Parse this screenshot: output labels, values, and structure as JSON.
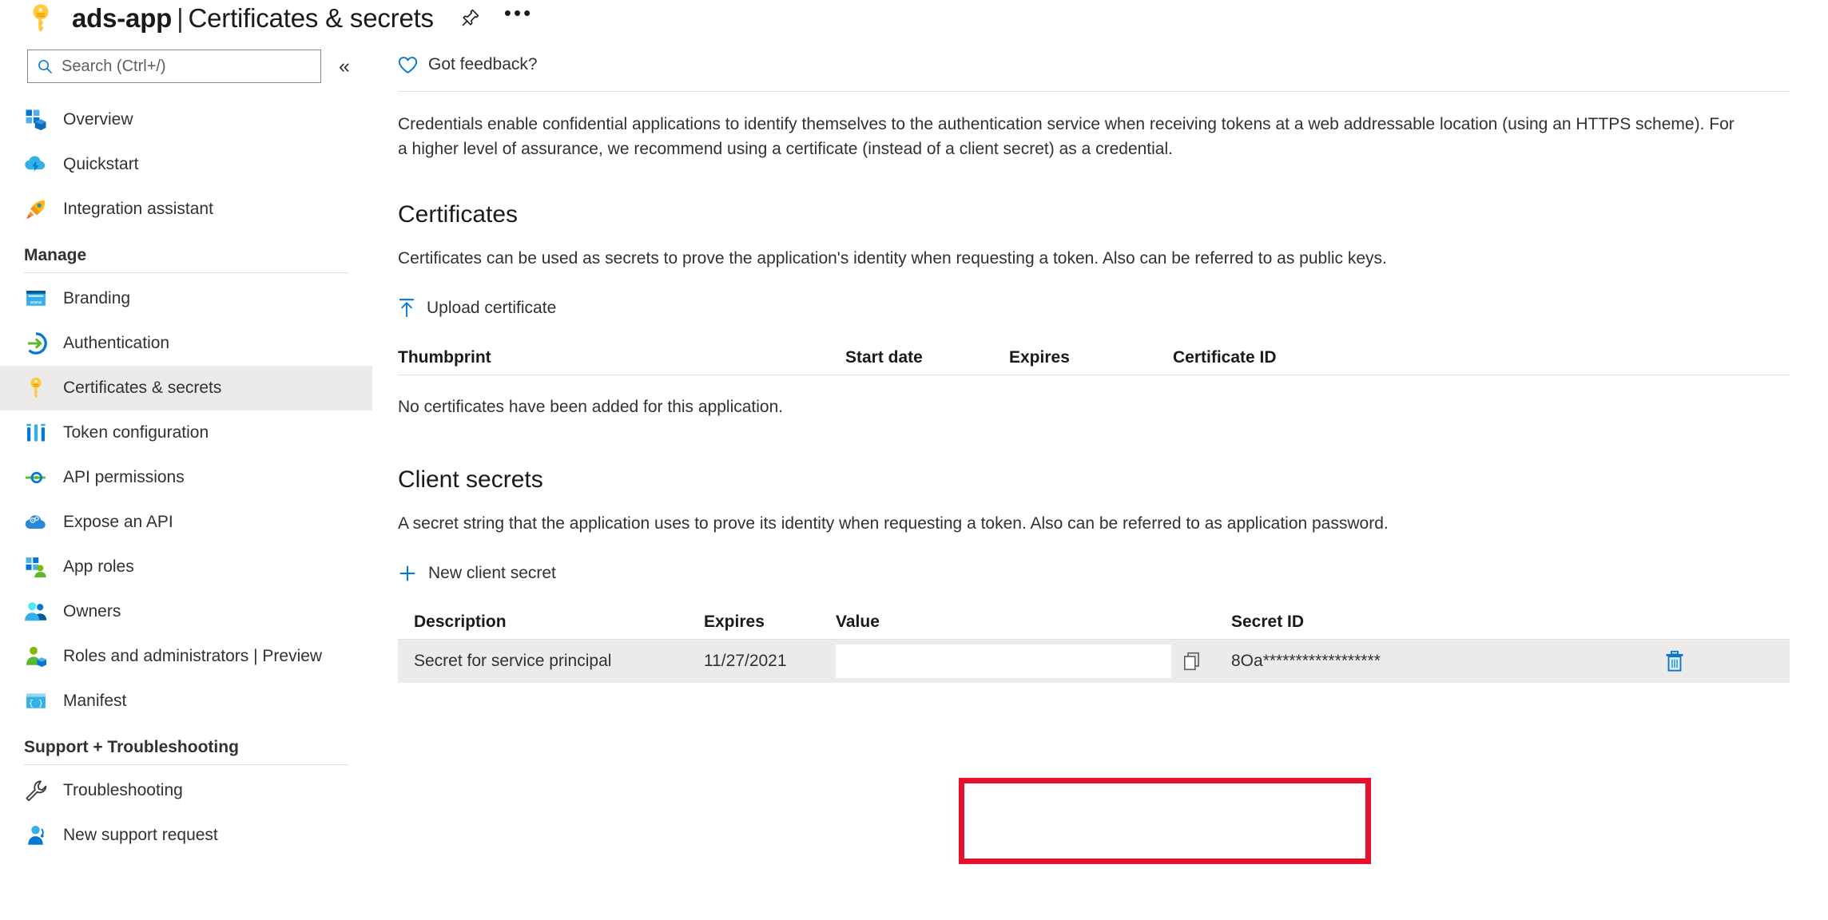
{
  "header": {
    "app_name": "ads-app",
    "separator": "|",
    "page_name": "Certificates & secrets",
    "key_icon": "key-icon",
    "pin_icon": "pin-icon",
    "more_label": "•••"
  },
  "sidebar": {
    "search": {
      "placeholder": "Search (Ctrl+/)",
      "value": "",
      "icon": "search-icon"
    },
    "collapse_label": "«",
    "top_items": [
      {
        "label": "Overview",
        "icon": "overview-icon",
        "selected": false
      },
      {
        "label": "Quickstart",
        "icon": "quickstart-icon",
        "selected": false
      },
      {
        "label": "Integration assistant",
        "icon": "rocket-icon",
        "selected": false
      }
    ],
    "groups": [
      {
        "title": "Manage",
        "items": [
          {
            "label": "Branding",
            "icon": "branding-icon",
            "selected": false
          },
          {
            "label": "Authentication",
            "icon": "authentication-icon",
            "selected": false
          },
          {
            "label": "Certificates & secrets",
            "icon": "key-icon",
            "selected": true
          },
          {
            "label": "Token configuration",
            "icon": "token-icon",
            "selected": false
          },
          {
            "label": "API permissions",
            "icon": "api-permissions-icon",
            "selected": false
          },
          {
            "label": "Expose an API",
            "icon": "expose-api-icon",
            "selected": false
          },
          {
            "label": "App roles",
            "icon": "app-roles-icon",
            "selected": false
          },
          {
            "label": "Owners",
            "icon": "owners-icon",
            "selected": false
          },
          {
            "label": "Roles and administrators | Preview",
            "icon": "roles-admin-icon",
            "selected": false
          },
          {
            "label": "Manifest",
            "icon": "manifest-icon",
            "selected": false
          }
        ]
      },
      {
        "title": "Support + Troubleshooting",
        "items": [
          {
            "label": "Troubleshooting",
            "icon": "wrench-icon",
            "selected": false
          },
          {
            "label": "New support request",
            "icon": "support-agent-icon",
            "selected": false
          }
        ]
      }
    ]
  },
  "main": {
    "feedback": {
      "label": "Got feedback?",
      "icon": "heart-icon"
    },
    "intro": "Credentials enable confidential applications to identify themselves to the authentication service when receiving tokens at a web addressable location (using an HTTPS scheme). For a higher level of assurance, we recommend using a certificate (instead of a client secret) as a credential.",
    "certificates": {
      "heading": "Certificates",
      "description": "Certificates can be used as secrets to prove the application's identity when requesting a token. Also can be referred to as public keys.",
      "upload_button": {
        "label": "Upload certificate",
        "icon": "upload-icon"
      },
      "columns": [
        "Thumbprint",
        "Start date",
        "Expires",
        "Certificate ID"
      ],
      "rows": [],
      "empty_message": "No certificates have been added for this application."
    },
    "client_secrets": {
      "heading": "Client secrets",
      "description": "A secret string that the application uses to prove its identity when requesting a token. Also can be referred to as application password.",
      "new_button": {
        "label": "New client secret",
        "icon": "plus-icon"
      },
      "columns": [
        "Description",
        "Expires",
        "Value",
        "Secret ID"
      ],
      "rows": [
        {
          "description": "Secret for service principal",
          "expires": "11/27/2021",
          "value": "",
          "value_placeholder": "",
          "secret_id": "8Oa******************",
          "copy_icon": "copy-icon",
          "delete_icon": "trash-icon"
        }
      ]
    }
  },
  "annotation": {
    "type": "rectangle-highlight",
    "target": "client-secret-value-cell",
    "color": "#e8112d"
  }
}
